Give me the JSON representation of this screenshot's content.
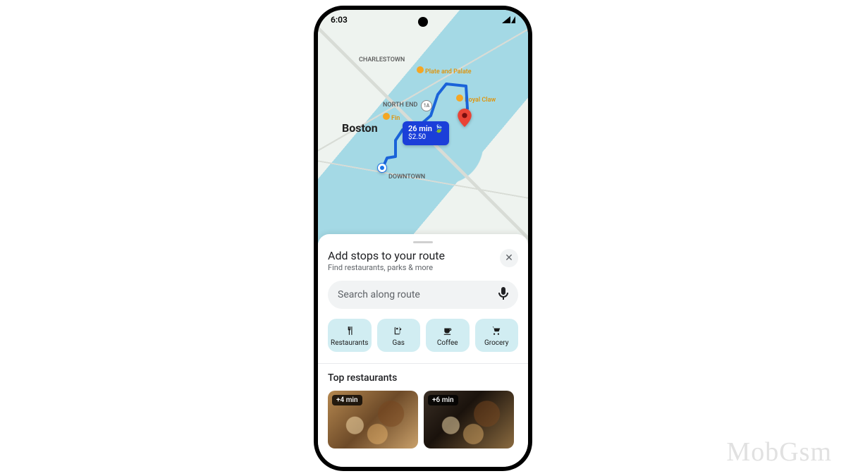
{
  "status": {
    "time": "6:03"
  },
  "map": {
    "city": "Boston",
    "labels": {
      "charlestown": "CHARLESTOWN",
      "north_end": "NORTH END",
      "downtown": "DOWNTOWN"
    },
    "route_shield": "1A",
    "pois": {
      "plate": "Plate and Palate",
      "fin": "Fin",
      "royal": "Royal Claw"
    },
    "route_badge": {
      "time": "26 min",
      "price": "$2.50"
    }
  },
  "sheet": {
    "title": "Add stops to your route",
    "subtitle": "Find restaurants, parks & more",
    "search_placeholder": "Search along route",
    "chips": [
      {
        "id": "restaurants",
        "label": "Restaurants"
      },
      {
        "id": "gas",
        "label": "Gas"
      },
      {
        "id": "coffee",
        "label": "Coffee"
      },
      {
        "id": "grocery",
        "label": "Grocery"
      }
    ],
    "section": "Top restaurants",
    "cards": [
      {
        "delta": "+4 min"
      },
      {
        "delta": "+6 min"
      }
    ]
  },
  "watermark": "MobGsm"
}
